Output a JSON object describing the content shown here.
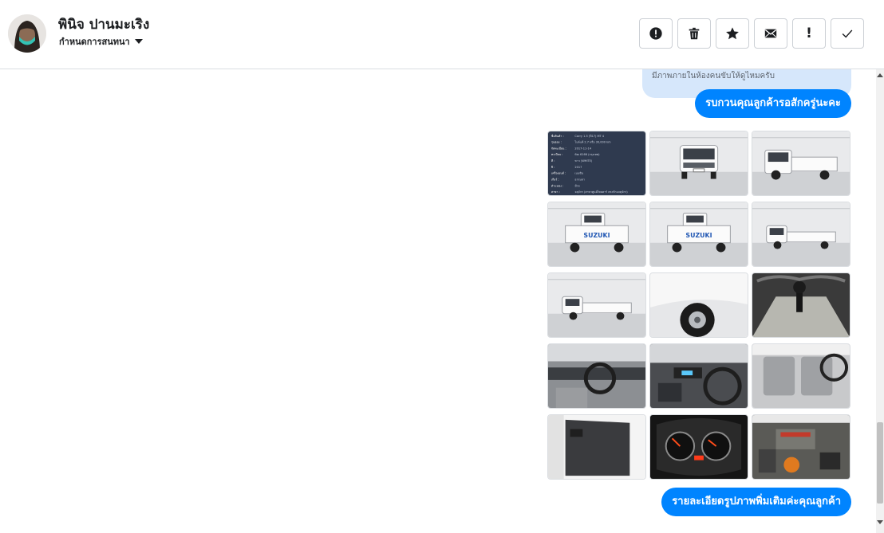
{
  "header": {
    "contact_name": "พินิจ ปานมะเริง",
    "assign_label": "กำหนดการสนทนา",
    "toolbar": [
      {
        "name": "spam-button",
        "icon": "alert-circle-icon",
        "symbol": ""
      },
      {
        "name": "delete-button",
        "icon": "trash-icon",
        "symbol": ""
      },
      {
        "name": "star-button",
        "icon": "star-icon",
        "symbol": ""
      },
      {
        "name": "mark-unread-button",
        "icon": "envelope-icon",
        "symbol": ""
      },
      {
        "name": "important-button",
        "icon": "exclamation-icon",
        "symbol": "!"
      },
      {
        "name": "done-button",
        "icon": "checkmark-icon",
        "symbol": ""
      }
    ]
  },
  "conversation": {
    "quoted_text": "มีภาพภายในห้องคนขับให้ดูไหมครับ",
    "message_1": "รบกวนคุณลูกค้ารอสักครู่นะคะ",
    "message_2": "รายละเอียดรูปภาพพิ่มเติมค่ะคุณลูกค้า",
    "spec_sheet": {
      "rows": [
        [
          "ชื่อสินค้า :",
          "Carry 1.5 (ปี17) MT 4"
        ],
        [
          "รุ่นย่อย :",
          "ไมล์แท้ 2.7 หรือ 30,000 km"
        ],
        [
          "จัดทะเบียน :",
          "2017-11-14"
        ],
        [
          "ทะเบียน :",
          "6ฒ 6166 (กรุงเทพ)"
        ],
        [
          "สี :",
          "ขาว (WHITE)"
        ],
        [
          "ปี :",
          "2017"
        ],
        [
          "เครื่องยนต์ :",
          "เบนซิน"
        ],
        [
          "เกียร์ :",
          "ธรรมดา"
        ],
        [
          "ตำแหน่ง :",
          "มีรถ"
        ],
        [
          "สาขา :",
          "จตุจักร (สาขาศูนย์ไทยคาร์ ตรงข้ามจตุจักร)"
        ]
      ]
    },
    "photos": [
      {
        "name": "photo-spec-sheet",
        "kind": "spec"
      },
      {
        "name": "photo-truck-front",
        "kind": "truck-front"
      },
      {
        "name": "photo-truck-front-three-quarter",
        "kind": "truck-34"
      },
      {
        "name": "photo-truck-rear-three-quarter-left",
        "kind": "truck-rear",
        "badge": "SUZUKI"
      },
      {
        "name": "photo-truck-rear-three-quarter-right",
        "kind": "truck-rear",
        "badge": "SUZUKI"
      },
      {
        "name": "photo-truck-side-right",
        "kind": "truck-side"
      },
      {
        "name": "photo-truck-side-left",
        "kind": "truck-side"
      },
      {
        "name": "photo-front-wheel",
        "kind": "wheel"
      },
      {
        "name": "photo-gear-shifter",
        "kind": "shifter"
      },
      {
        "name": "photo-dashboard-driver",
        "kind": "interior"
      },
      {
        "name": "photo-center-console",
        "kind": "console"
      },
      {
        "name": "photo-seats",
        "kind": "seat"
      },
      {
        "name": "photo-door-panel",
        "kind": "door"
      },
      {
        "name": "photo-instrument-cluster",
        "kind": "gauge"
      },
      {
        "name": "photo-engine-bay",
        "kind": "engine"
      }
    ]
  },
  "colors": {
    "accent": "#0084ff",
    "quoted_bg": "#d6e7fb",
    "spec_bg": "#2f3a4f"
  }
}
